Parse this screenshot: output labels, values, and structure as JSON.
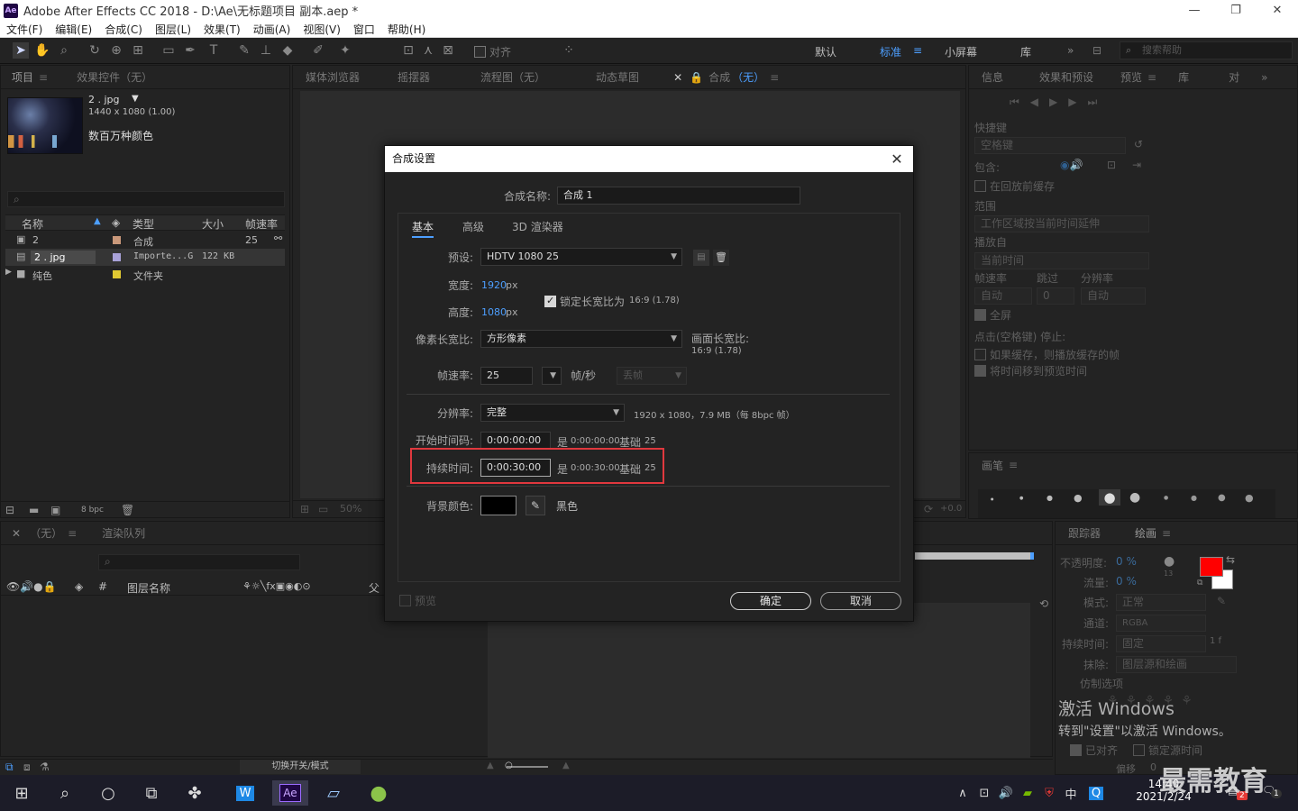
{
  "window": {
    "title": "Adobe After Effects CC 2018 - D:\\Ae\\无标题项目 副本.aep *",
    "logo": "Ae"
  },
  "menu": [
    "文件(F)",
    "编辑(E)",
    "合成(C)",
    "图层(L)",
    "效果(T)",
    "动画(A)",
    "视图(V)",
    "窗口",
    "帮助(H)"
  ],
  "toolbar": {
    "align_label": "对齐",
    "workspaces": [
      "默认",
      "标准",
      "小屏幕",
      "库"
    ],
    "active_workspace": "标准",
    "search_placeholder": "搜索帮助"
  },
  "project_panel": {
    "tab_project": "项目",
    "tab_effects": "效果控件（无）",
    "item_name": "2 . jpg",
    "item_dims": "1440 x 1080 (1.00)",
    "item_colors": "数百万种颜色",
    "columns": {
      "name": "名称",
      "type": "类型",
      "size": "大小",
      "fps": "帧速率"
    },
    "rows": [
      {
        "name": "2",
        "type": "合成",
        "size": "",
        "fps": "25",
        "color": "#c9987a"
      },
      {
        "name": "2 . jpg",
        "type": "Importe...G",
        "size": "122 KB",
        "fps": "",
        "color": "#a9a2d8"
      },
      {
        "name": "纯色",
        "type": "文件夹",
        "size": "",
        "fps": "",
        "color": "#e0c832"
      }
    ],
    "bpc": "8 bpc"
  },
  "center_tabs": {
    "media_browser": "媒体浏览器",
    "wiggler": "摇摆器",
    "flowchart": "流程图（无）",
    "motion_sketch": "动态草图",
    "comp_label": "合成",
    "comp_name": "（无）",
    "zoom": "50%",
    "offset": "+0.0"
  },
  "dialog": {
    "title": "合成设置",
    "comp_name_label": "合成名称:",
    "comp_name_value": "合成 1",
    "tabs": [
      "基本",
      "高级",
      "3D 渲染器"
    ],
    "preset_label": "预设:",
    "preset_value": "HDTV 1080 25",
    "width_label": "宽度:",
    "width_value": "1920",
    "height_label": "高度:",
    "height_value": "1080",
    "px": "px",
    "lock_label": "锁定长宽比为",
    "lock_ratio": "16:9 (1.78)",
    "pixel_aspect_label": "像素长宽比:",
    "pixel_aspect_value": "方形像素",
    "frame_aspect_label": "画面长宽比:",
    "frame_aspect_value": "16:9 (1.78)",
    "fps_label": "帧速率:",
    "fps_value": "25",
    "fps_unit": "帧/秒",
    "drop_frame": "丢帧",
    "resolution_label": "分辨率:",
    "resolution_value": "完整",
    "resolution_info": "1920 x 1080，7.9 MB（每 8bpc 帧）",
    "start_tc_label": "开始时间码:",
    "start_tc_value": "0:00:00:00",
    "start_tc_info_prefix": "是",
    "start_tc_info": "0:00:00:00",
    "base_label": "基础",
    "base_value": "25",
    "duration_label": "持续时间:",
    "duration_value": "0:00:30:00",
    "duration_info_prefix": "是",
    "duration_info": "0:00:30:00",
    "bg_label": "背景颜色:",
    "bg_color": "#000000",
    "bg_name": "黑色",
    "preview_label": "预览",
    "ok_label": "确定",
    "cancel_label": "取消"
  },
  "timeline": {
    "tab_none": "（无）",
    "tab_render": "渲染队列",
    "layer_name_col": "图层名称",
    "parent_col": "父",
    "switch_modes": "切换开关/模式",
    "hash": "#"
  },
  "right_panel": {
    "tabs": [
      "信息",
      "效果和预设",
      "预览",
      "库",
      "对"
    ],
    "shortcut_label": "快捷键",
    "shortcut_value": "空格键",
    "include_label": "包含:",
    "cache_before": "在回放前缓存",
    "range_label": "范围",
    "range_value": "工作区域按当前时间延伸",
    "play_from_label": "播放自",
    "play_from_value": "当前时间",
    "fps_label": "帧速率",
    "skip_label": "跳过",
    "res_label": "分辨率",
    "fps_value": "自动",
    "skip_value": "0",
    "res_value": "自动",
    "fullscreen": "全屏",
    "stop_label": "点击(空格键) 停止:",
    "if_cached": "如果缓存，则播放缓存的帧",
    "move_time": "将时间移到预览时间",
    "brush_tab": "画笔",
    "brush_sizes": [
      "1",
      "3",
      "5",
      "9",
      "13",
      "19",
      "5",
      "9",
      "13",
      "17"
    ]
  },
  "paint_panel": {
    "tracker_tab": "跟踪器",
    "paint_tab": "绘画",
    "opacity_label": "不透明度:",
    "opacity_value": "0 %",
    "flow_label": "流量:",
    "flow_value": "0 %",
    "mode_label": "模式:",
    "mode_value": "正常",
    "channel_label": "通道:",
    "channel_value": "RGBA",
    "duration_label": "持续时间:",
    "duration_value": "固定",
    "duration_frames": "1 f",
    "erase_label": "抹除:",
    "erase_value": "图层源和绘画",
    "clone_label": "仿制选项",
    "aligned": "已对齐",
    "lock_source": "锁定源时间",
    "offset_label": "偏移",
    "offset_value": "0",
    "brush_size": "13",
    "fg_color": "#ff0000",
    "bg_color": "#ffffff"
  },
  "watermark": {
    "line1": "激活 Windows",
    "line2": "转到\"设置\"以激活 Windows。",
    "brand": "最需教育"
  },
  "taskbar": {
    "time": "14:40",
    "date": "2021/2/24",
    "lang": "中",
    "badge1": "2",
    "badge2": "1"
  }
}
